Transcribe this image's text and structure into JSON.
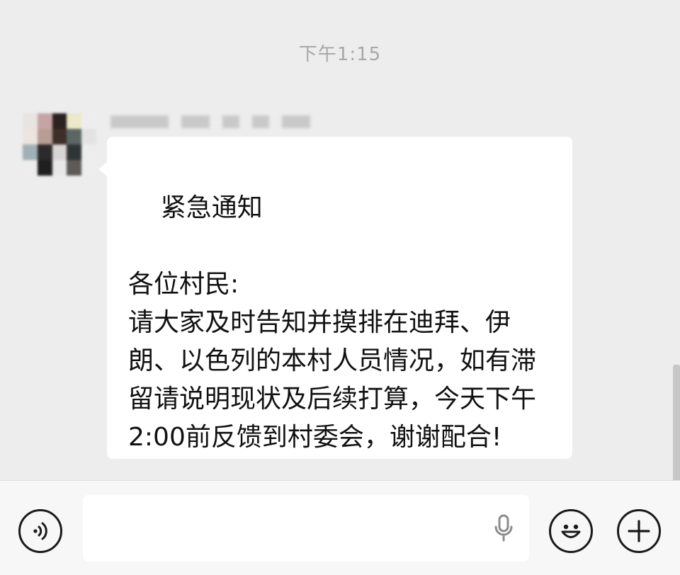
{
  "chat": {
    "timestamp": "下午1:15",
    "message": {
      "text": "紧急通知\n\n各位村民:\n请大家及时告知并摸排在迪拜、伊朗、以色列的本村人员情况，如有滞留请说明现状及后续打算，今天下午2:00前反馈到村委会，谢谢配合!"
    }
  },
  "input_bar": {
    "voice_icon": "voice-mode-icon",
    "mic_icon": "microphone-icon",
    "emoji_icon": "smiley-face-icon",
    "plus_icon": "plus-icon"
  },
  "colors": {
    "background": "#ededed",
    "bubble": "#ffffff",
    "text": "#111111",
    "timestamp": "#a8a8a8",
    "input_bar": "#f7f7f7"
  }
}
